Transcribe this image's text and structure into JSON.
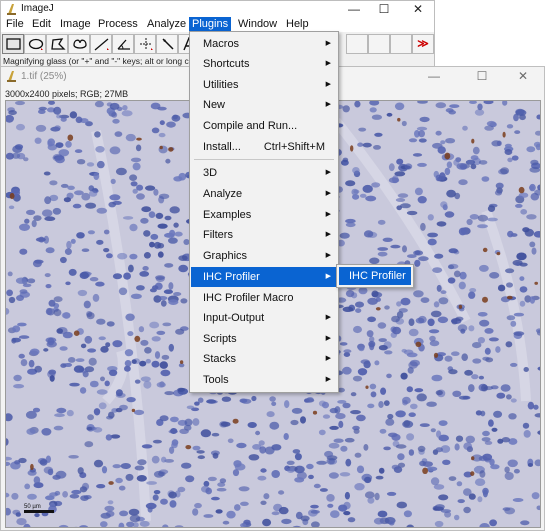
{
  "image_window": {
    "title": "1.tif (25%)",
    "info": "3000x2400 pixels; RGB; 27MB",
    "scalebar_label": "50 µm",
    "controls": {
      "minimize": "—",
      "maximize": "☐",
      "close": "✕"
    }
  },
  "main_window": {
    "title": "ImageJ",
    "controls": {
      "minimize": "—",
      "maximize": "☐",
      "close": "✕"
    },
    "menubar": [
      "File",
      "Edit",
      "Image",
      "Process",
      "Analyze",
      "Plugins",
      "Window",
      "Help"
    ],
    "active_menu": "Plugins",
    "status": "Magnifying glass (or \"+\" and \"-\" keys; alt or long click to zoom out)",
    "tools": [
      "rectangle-tool",
      "oval-tool",
      "polygon-tool",
      "freehand-tool",
      "line-tool",
      "angle-tool",
      "point-tool",
      "wand-tool",
      "text-tool"
    ],
    "toolbar_more": "≫"
  },
  "plugins_menu": {
    "items": [
      {
        "label": "Macros",
        "submenu": true
      },
      {
        "label": "Shortcuts",
        "submenu": true
      },
      {
        "label": "Utilities",
        "submenu": true
      },
      {
        "label": "New",
        "submenu": true
      },
      {
        "label": "Compile and Run...",
        "submenu": false
      },
      {
        "label": "Install...",
        "submenu": false,
        "shortcut": "Ctrl+Shift+M"
      },
      {
        "label": "3D",
        "submenu": true
      },
      {
        "label": "Analyze",
        "submenu": true
      },
      {
        "label": "Examples",
        "submenu": true
      },
      {
        "label": "Filters",
        "submenu": true
      },
      {
        "label": "Graphics",
        "submenu": true
      },
      {
        "label": "IHC Profiler",
        "submenu": true,
        "highlighted": true
      },
      {
        "label": "IHC Profiler Macro",
        "submenu": false
      },
      {
        "label": "Input-Output",
        "submenu": true
      },
      {
        "label": "Scripts",
        "submenu": true
      },
      {
        "label": "Stacks",
        "submenu": true
      },
      {
        "label": "Tools",
        "submenu": true
      }
    ],
    "arrow": "▶"
  },
  "ihc_submenu": {
    "items": [
      {
        "label": "IHC Profiler"
      }
    ]
  },
  "colors": {
    "highlight": "#0a64d2",
    "tissue_bg": "#c9c9dc",
    "nuclei": "#4a5aa8",
    "stain": "#7a3d1c"
  }
}
